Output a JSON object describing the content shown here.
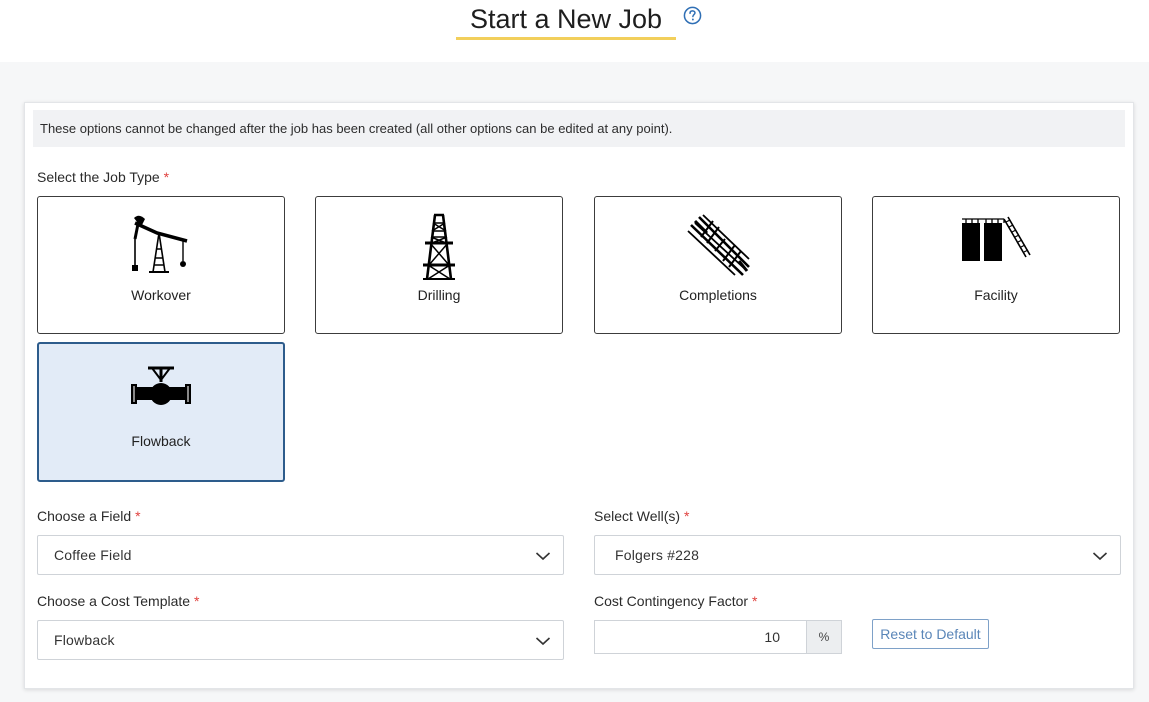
{
  "header": {
    "title": "Start a New Job"
  },
  "notice": "These options cannot be changed after the job has been created (all other options can be edited at any point).",
  "job_type": {
    "label": "Select the Job Type",
    "required_mark": "*",
    "options": [
      {
        "label": "Workover",
        "icon": "pumpjack-icon"
      },
      {
        "label": "Drilling",
        "icon": "derrick-icon"
      },
      {
        "label": "Completions",
        "icon": "pipes-icon"
      },
      {
        "label": "Facility",
        "icon": "tanks-icon"
      },
      {
        "label": "Flowback",
        "icon": "valve-icon"
      }
    ],
    "selected": "Flowback"
  },
  "field": {
    "label": "Choose a Field",
    "required_mark": "*",
    "value": "Coffee Field"
  },
  "wells": {
    "label": "Select Well(s)",
    "required_mark": "*",
    "value": "Folgers #228"
  },
  "cost_template": {
    "label": "Choose a Cost Template",
    "required_mark": "*",
    "value": "Flowback"
  },
  "contingency": {
    "label": "Cost Contingency Factor",
    "required_mark": "*",
    "value": "10",
    "unit": "%",
    "reset_label": "Reset to Default"
  },
  "colors": {
    "accent_underline": "#f2cf5b",
    "selected_bg": "#e2ebf7",
    "selected_border": "#2d5c8c",
    "required": "#e0413e",
    "link_blue": "#5a86b8"
  }
}
